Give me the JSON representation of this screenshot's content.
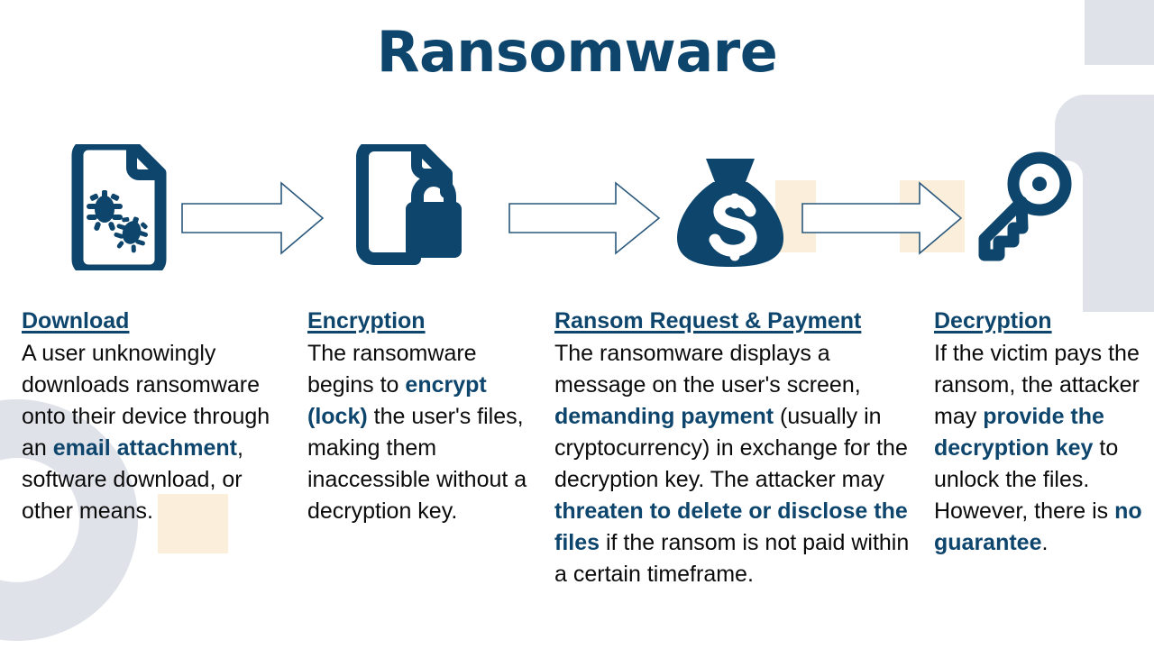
{
  "slide": {
    "title": "Ransomware",
    "accent_blue": "#0d456d",
    "body_text_color": "#0b0b0b",
    "cream_accent": "#fbeedb",
    "gray_accent": "#dfe3e9",
    "background": "#ffffff"
  },
  "icons": [
    {
      "name": "infected-document-icon",
      "label": "document with virus bugs"
    },
    {
      "name": "arrow-right-outline-icon-1",
      "label": "arrow right"
    },
    {
      "name": "locked-document-icon",
      "label": "document with padlock"
    },
    {
      "name": "arrow-right-outline-icon-2",
      "label": "arrow right"
    },
    {
      "name": "money-bag-dollar-icon",
      "label": "money bag with dollar sign"
    },
    {
      "name": "arrow-right-outline-icon-3",
      "label": "arrow right"
    },
    {
      "name": "key-icon",
      "label": "key"
    }
  ],
  "columns": [
    {
      "heading": "Download",
      "body_runs": [
        {
          "text": "A user unknowingly downloads ransomware onto their device through an ",
          "bold": false
        },
        {
          "text": "email attachment",
          "bold": true
        },
        {
          "text": ", software download, or other means.",
          "bold": false
        }
      ]
    },
    {
      "heading": "Encryption",
      "body_runs": [
        {
          "text": "The ransomware begins to ",
          "bold": false
        },
        {
          "text": "encrypt (lock)",
          "bold": true
        },
        {
          "text": " the user's files, making them inaccessible without a decryption key.",
          "bold": false
        }
      ]
    },
    {
      "heading": "Ransom Request & Payment",
      "body_runs": [
        {
          "text": "The ransomware displays a message on the user's screen, ",
          "bold": false
        },
        {
          "text": "demanding payment",
          "bold": true
        },
        {
          "text": " (usually in cryptocurrency) in exchange for the decryption key. The attacker may ",
          "bold": false
        },
        {
          "text": "threaten to delete or disclose the files",
          "bold": true
        },
        {
          "text": " if the ransom is not paid within a certain timeframe.",
          "bold": false
        }
      ]
    },
    {
      "heading": "Decryption",
      "body_runs": [
        {
          "text": "If the victim pays the ransom, the attacker may ",
          "bold": false
        },
        {
          "text": "provide the decryption key",
          "bold": true
        },
        {
          "text": " to unlock the files. However, there is ",
          "bold": false
        },
        {
          "text": "no guarantee",
          "bold": true
        },
        {
          "text": ".",
          "bold": false
        }
      ]
    }
  ]
}
